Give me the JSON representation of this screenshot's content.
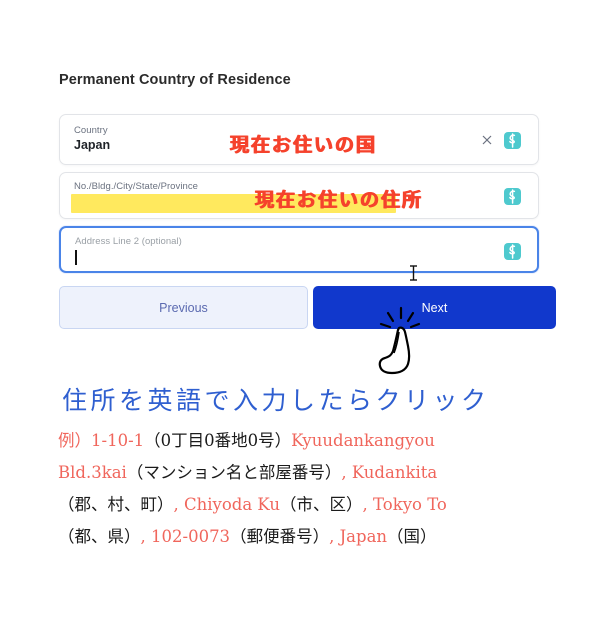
{
  "section": {
    "title": "Permanent Country of Residence"
  },
  "form": {
    "fields": [
      {
        "label": "Country",
        "value": "Japan",
        "placeholder": "",
        "clear_icon": "close-icon",
        "pm_icon": "password-manager-icon",
        "focused": false,
        "highlighted": false
      },
      {
        "label": "No./Bldg./City/State/Province",
        "value": "",
        "placeholder": "",
        "pm_icon": "password-manager-icon",
        "focused": false,
        "highlighted": true
      },
      {
        "label": "Address Line 2 (optional)",
        "value": "",
        "placeholder": "Address Line 2 (optional)",
        "pm_icon": "password-manager-icon",
        "focused": true,
        "highlighted": false
      }
    ]
  },
  "buttons": {
    "previous_label": "Previous",
    "next_label": "Next"
  },
  "annotations": {
    "country_note": "現在お住いの国",
    "address_note": "現在お住いの住所",
    "click_instruction": "住所を英語で入力したらクリック",
    "example_lines": [
      [
        {
          "text": "例）",
          "color": "red"
        },
        {
          "text": "1-10-1",
          "color": "red"
        },
        {
          "text": "（0丁目0番地0号）",
          "color": "black"
        },
        {
          "text": "Kyuudankangyou",
          "color": "red"
        }
      ],
      [
        {
          "text": "Bld.3kai",
          "color": "red"
        },
        {
          "text": "（マンション名と部屋番号）",
          "color": "black"
        },
        {
          "text": ", ",
          "color": "red"
        },
        {
          "text": "Kudankita",
          "color": "red"
        }
      ],
      [
        {
          "text": "（郡、村、町）",
          "color": "black"
        },
        {
          "text": ", ",
          "color": "red"
        },
        {
          "text": "Chiyoda Ku",
          "color": "red"
        },
        {
          "text": "（市、区）",
          "color": "black"
        },
        {
          "text": ", ",
          "color": "red"
        },
        {
          "text": "Tokyo To",
          "color": "red"
        }
      ],
      [
        {
          "text": "（都、県）",
          "color": "black"
        },
        {
          "text": ", ",
          "color": "red"
        },
        {
          "text": "102-0073",
          "color": "red"
        },
        {
          "text": "（郵便番号）",
          "color": "black"
        },
        {
          "text": ", ",
          "color": "red"
        },
        {
          "text": "Japan",
          "color": "red"
        },
        {
          "text": "（国）",
          "color": "black"
        }
      ]
    ]
  },
  "cursors": {
    "pointer_hand": "pointing-hand-illustration",
    "text_ibeam": "ibeam-cursor"
  },
  "colors": {
    "accent_blue": "#1138cc",
    "prev_button_bg": "#eef2fc",
    "focus_border": "#4a84e8",
    "highlight_yellow": "#ffe95e",
    "annotation_red": "#f5422c",
    "annotation_blue": "#2f5fd0",
    "example_red": "#f0665c",
    "pm_icon_teal": "#4ec9ce"
  }
}
